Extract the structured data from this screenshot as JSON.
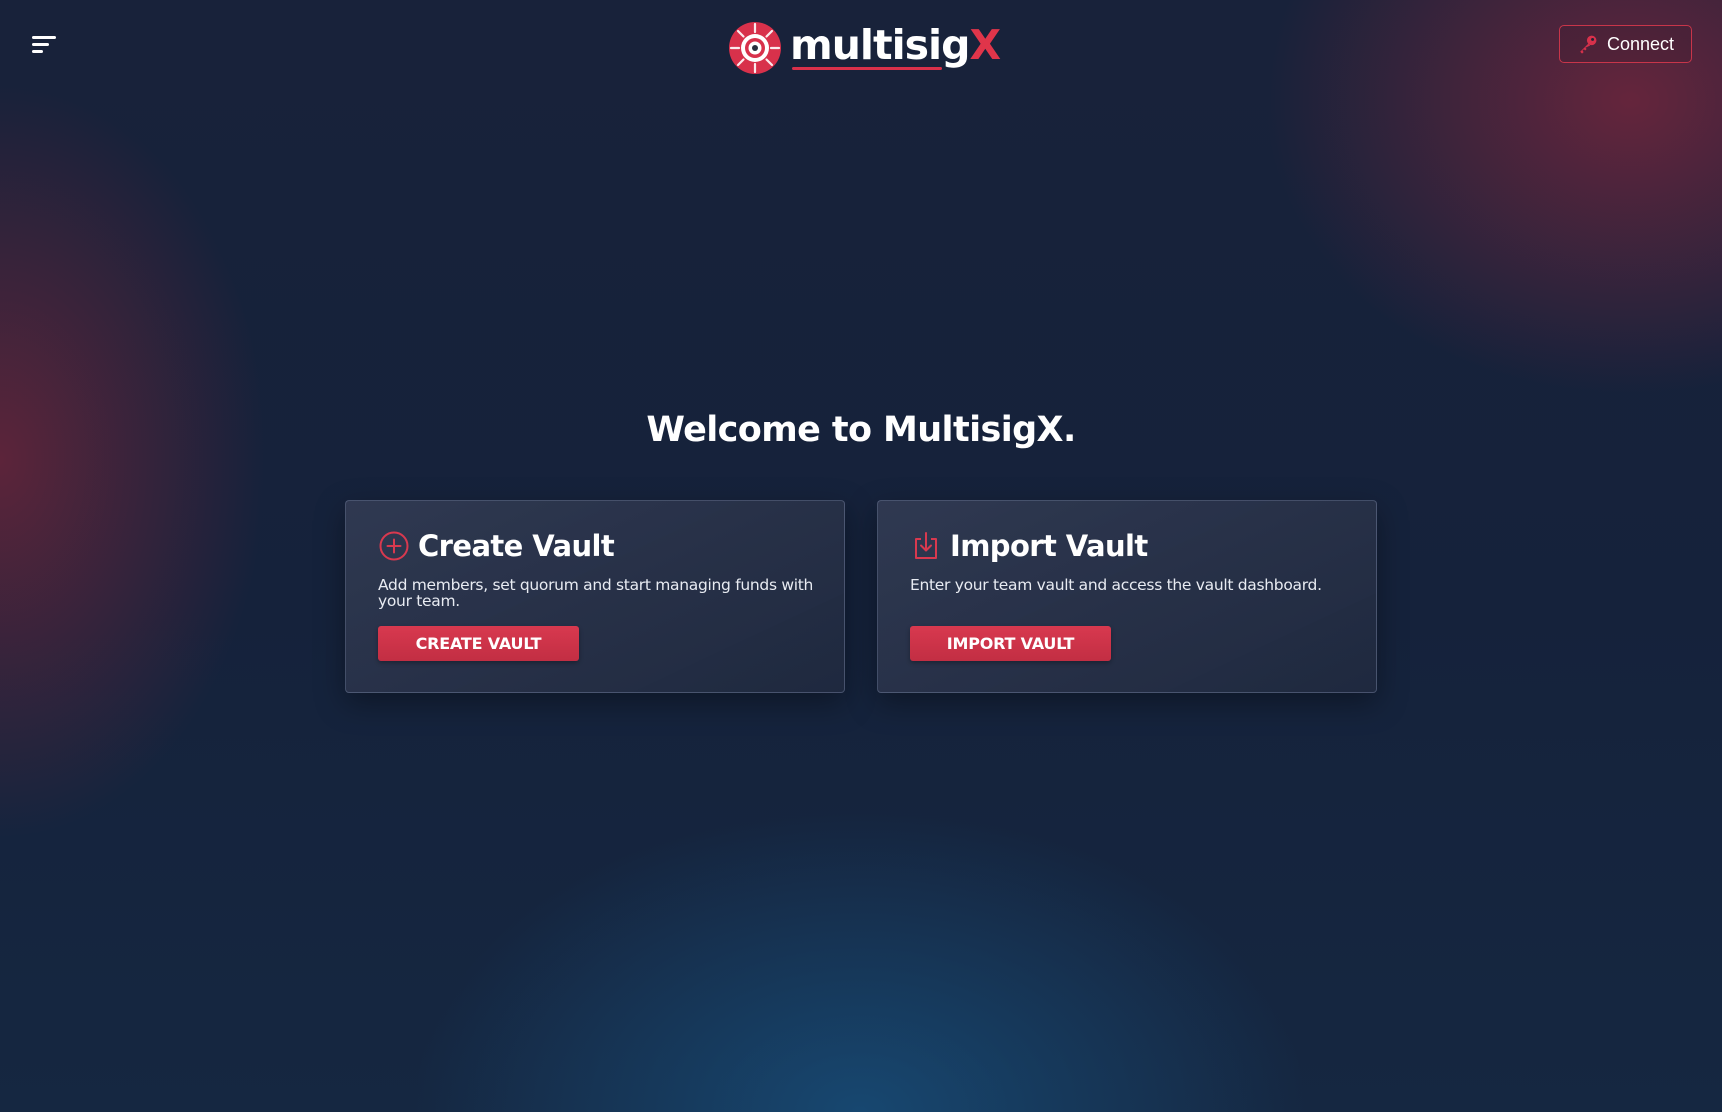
{
  "header": {
    "menu_icon": "hamburger-menu-icon",
    "logo": {
      "text_main": "multisig",
      "text_accent": "X",
      "mark_icon": "target-logo-icon",
      "accent_color": "#e0354a"
    },
    "connect_button": {
      "label": "Connect",
      "icon": "key-icon"
    }
  },
  "main": {
    "welcome_title": "Welcome to MultisigX.",
    "cards": [
      {
        "icon": "plus-circle-icon",
        "title": "Create Vault",
        "description": "Add members, set quorum and start managing funds with your team.",
        "button_label": "CREATE VAULT"
      },
      {
        "icon": "import-download-icon",
        "title": "Import Vault",
        "description": "Enter your team vault and access the vault dashboard.",
        "button_label": "IMPORT VAULT"
      }
    ]
  },
  "colors": {
    "background": "#15223a",
    "accent": "#d8394f",
    "card_border": "#7d8caa"
  }
}
